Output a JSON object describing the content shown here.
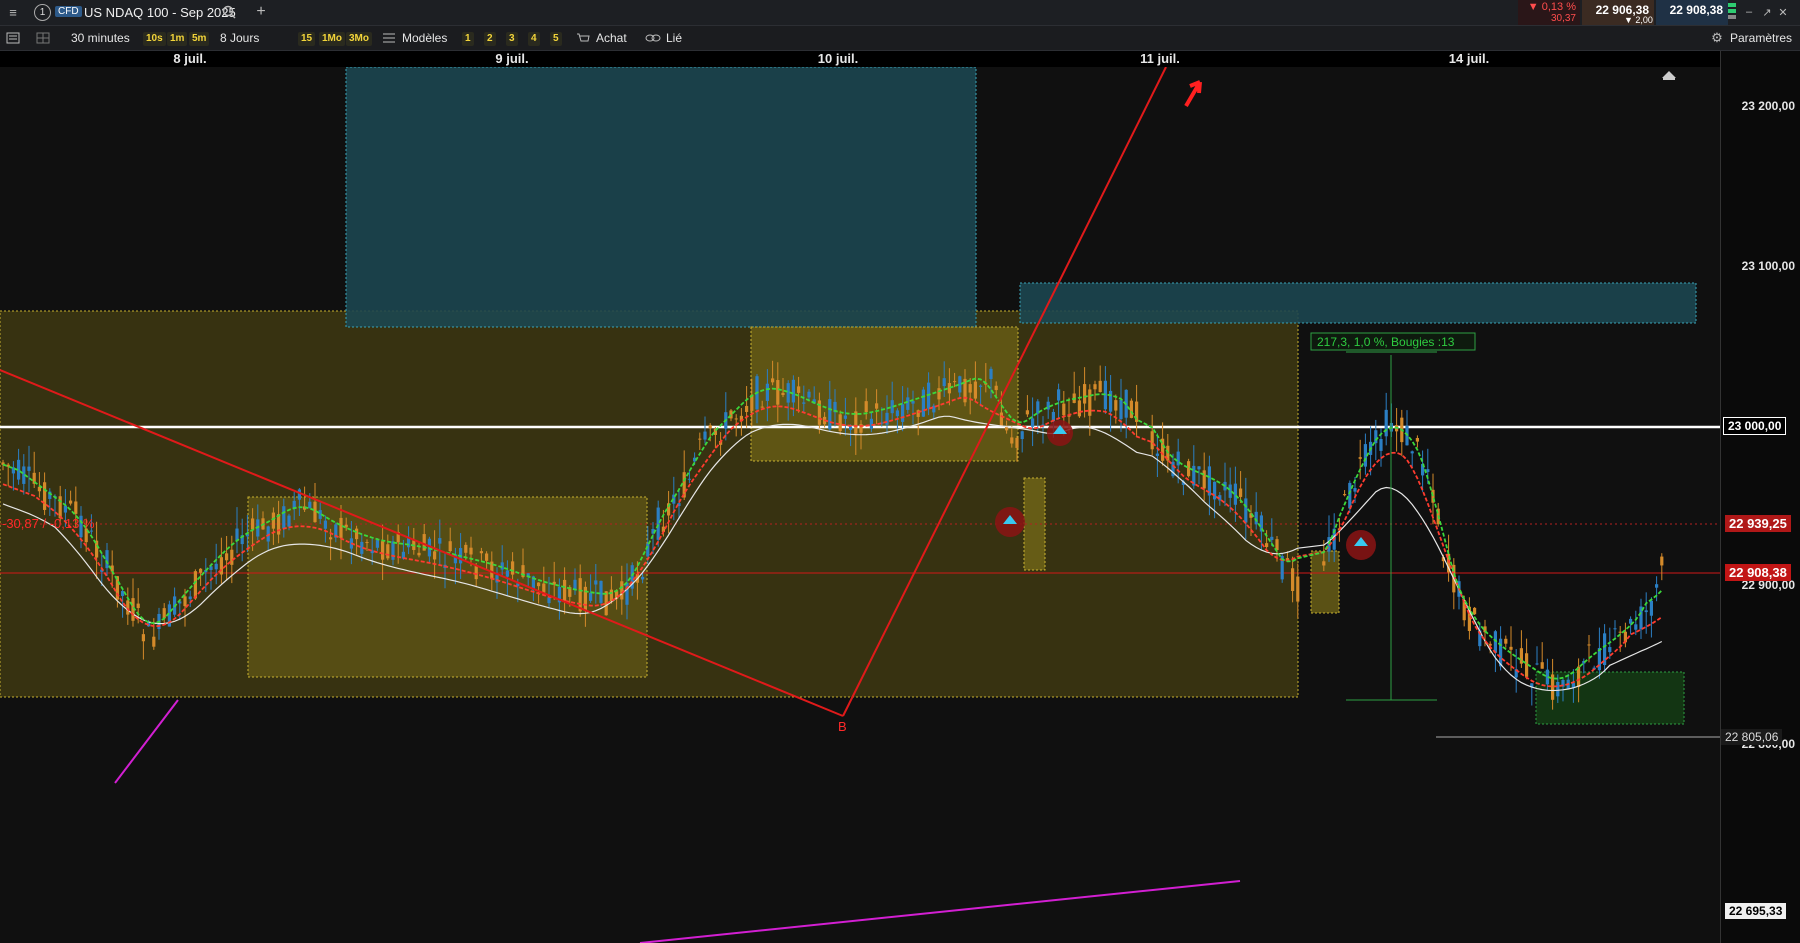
{
  "header": {
    "instrument_num": "1",
    "cfd_badge": "CFD",
    "title": "US NDAQ 100 - Sep 2025",
    "change_pct": "▼ 0,13 %",
    "change_abs": "30,37",
    "bid": "22 906,38",
    "ask": "22 908,38",
    "spread": "▼ 2,00"
  },
  "toolbar": {
    "interval": "30 minutes",
    "quick_intervals": [
      "10s",
      "1m",
      "5m"
    ],
    "range": "8 Jours",
    "range_buttons": [
      "15",
      "1Mo",
      "3Mo"
    ],
    "templates": "Modèles",
    "layout_buttons": [
      "1",
      "2",
      "3",
      "4",
      "5"
    ],
    "buy": "Achat",
    "linked": "Lié",
    "settings": "Paramètres"
  },
  "chart_data": {
    "type": "candlestick",
    "x_dates": [
      "8 juil.",
      "9 juil.",
      "10 juil.",
      "11 juil.",
      "14 juil."
    ],
    "y_ticks": [
      "23 200,00",
      "23 100,00",
      "22 900,00",
      "22 800,00"
    ],
    "ylim": [
      22695.33,
      23240
    ],
    "price_tags": {
      "level_23000": "23 000,00",
      "level_22939": "22 939,25",
      "last_price": "22 908,38",
      "low_22805": "22 805,06",
      "bottom_22695": "22 695,33"
    },
    "annotation_measure": "217,3, 1,0 %, Bougies :13",
    "annotation_left": "-30,87 / -0,13 %",
    "wave_label": "B",
    "colors": {
      "up": "#2b7fc4",
      "down": "#d48a2a",
      "zone_yellow": "#6b6010",
      "zone_teal": "#1c5560",
      "trend": "#e01a1a",
      "magenta": "#d21fd2"
    }
  }
}
